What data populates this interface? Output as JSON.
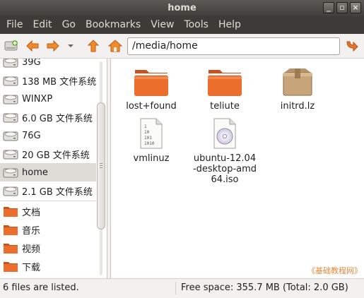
{
  "window": {
    "title": "home",
    "minimize": "_",
    "maximize": "▫",
    "close": "×"
  },
  "menu": [
    "File",
    "Edit",
    "Go",
    "Bookmarks",
    "View",
    "Tools",
    "Help"
  ],
  "location": {
    "path": "/media/home"
  },
  "sidebar": {
    "items": [
      {
        "label": "39G",
        "icon": "drive-icon"
      },
      {
        "label": "138 MB 文件系统",
        "icon": "drive-icon"
      },
      {
        "label": "WINXP",
        "icon": "drive-icon"
      },
      {
        "label": "6.0 GB 文件系统",
        "icon": "drive-icon"
      },
      {
        "label": "76G",
        "icon": "drive-icon"
      },
      {
        "label": "20 GB 文件系统",
        "icon": "drive-icon"
      },
      {
        "label": "home",
        "icon": "drive-icon",
        "selected": true
      },
      {
        "label": "2.1 GB 文件系统",
        "icon": "drive-icon"
      }
    ],
    "bookmarks": [
      {
        "label": "文档",
        "icon": "folder-icon"
      },
      {
        "label": "音乐",
        "icon": "folder-icon"
      },
      {
        "label": "视频",
        "icon": "folder-icon"
      },
      {
        "label": "下载",
        "icon": "folder-icon"
      }
    ]
  },
  "files": [
    {
      "name": "lost+found",
      "icon": "folder-icon"
    },
    {
      "name": "teliute",
      "icon": "folder-icon"
    },
    {
      "name": "initrd.lz",
      "icon": "package-icon"
    },
    {
      "name": "vmlinuz",
      "icon": "binary-file-icon"
    },
    {
      "name": "ubuntu-12.04-desktop-amd64.iso",
      "icon": "disc-image-icon"
    }
  ],
  "binary_glyph": [
    "1",
    "10",
    "101",
    "1010"
  ],
  "status": {
    "left": "6 files are listed.",
    "right": "Free space: 355.7 MB (Total: 2.0 GB)"
  },
  "watermark": "《基础教程网》",
  "colors": {
    "folder_orange": "#e86b2a",
    "titlebar": "#3c3b37",
    "menu_text": "#dfdbd2"
  }
}
